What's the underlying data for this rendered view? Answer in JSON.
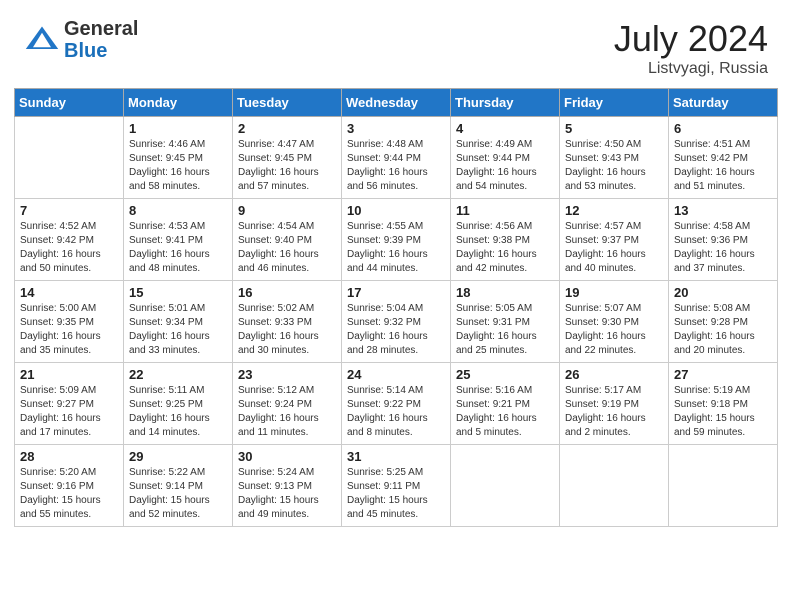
{
  "header": {
    "logo_general": "General",
    "logo_blue": "Blue",
    "month_year": "July 2024",
    "location": "Listvyagi, Russia"
  },
  "days_of_week": [
    "Sunday",
    "Monday",
    "Tuesday",
    "Wednesday",
    "Thursday",
    "Friday",
    "Saturday"
  ],
  "weeks": [
    [
      {
        "day": "",
        "sunrise": "",
        "sunset": "",
        "daylight": ""
      },
      {
        "day": "1",
        "sunrise": "Sunrise: 4:46 AM",
        "sunset": "Sunset: 9:45 PM",
        "daylight": "Daylight: 16 hours and 58 minutes."
      },
      {
        "day": "2",
        "sunrise": "Sunrise: 4:47 AM",
        "sunset": "Sunset: 9:45 PM",
        "daylight": "Daylight: 16 hours and 57 minutes."
      },
      {
        "day": "3",
        "sunrise": "Sunrise: 4:48 AM",
        "sunset": "Sunset: 9:44 PM",
        "daylight": "Daylight: 16 hours and 56 minutes."
      },
      {
        "day": "4",
        "sunrise": "Sunrise: 4:49 AM",
        "sunset": "Sunset: 9:44 PM",
        "daylight": "Daylight: 16 hours and 54 minutes."
      },
      {
        "day": "5",
        "sunrise": "Sunrise: 4:50 AM",
        "sunset": "Sunset: 9:43 PM",
        "daylight": "Daylight: 16 hours and 53 minutes."
      },
      {
        "day": "6",
        "sunrise": "Sunrise: 4:51 AM",
        "sunset": "Sunset: 9:42 PM",
        "daylight": "Daylight: 16 hours and 51 minutes."
      }
    ],
    [
      {
        "day": "7",
        "sunrise": "Sunrise: 4:52 AM",
        "sunset": "Sunset: 9:42 PM",
        "daylight": "Daylight: 16 hours and 50 minutes."
      },
      {
        "day": "8",
        "sunrise": "Sunrise: 4:53 AM",
        "sunset": "Sunset: 9:41 PM",
        "daylight": "Daylight: 16 hours and 48 minutes."
      },
      {
        "day": "9",
        "sunrise": "Sunrise: 4:54 AM",
        "sunset": "Sunset: 9:40 PM",
        "daylight": "Daylight: 16 hours and 46 minutes."
      },
      {
        "day": "10",
        "sunrise": "Sunrise: 4:55 AM",
        "sunset": "Sunset: 9:39 PM",
        "daylight": "Daylight: 16 hours and 44 minutes."
      },
      {
        "day": "11",
        "sunrise": "Sunrise: 4:56 AM",
        "sunset": "Sunset: 9:38 PM",
        "daylight": "Daylight: 16 hours and 42 minutes."
      },
      {
        "day": "12",
        "sunrise": "Sunrise: 4:57 AM",
        "sunset": "Sunset: 9:37 PM",
        "daylight": "Daylight: 16 hours and 40 minutes."
      },
      {
        "day": "13",
        "sunrise": "Sunrise: 4:58 AM",
        "sunset": "Sunset: 9:36 PM",
        "daylight": "Daylight: 16 hours and 37 minutes."
      }
    ],
    [
      {
        "day": "14",
        "sunrise": "Sunrise: 5:00 AM",
        "sunset": "Sunset: 9:35 PM",
        "daylight": "Daylight: 16 hours and 35 minutes."
      },
      {
        "day": "15",
        "sunrise": "Sunrise: 5:01 AM",
        "sunset": "Sunset: 9:34 PM",
        "daylight": "Daylight: 16 hours and 33 minutes."
      },
      {
        "day": "16",
        "sunrise": "Sunrise: 5:02 AM",
        "sunset": "Sunset: 9:33 PM",
        "daylight": "Daylight: 16 hours and 30 minutes."
      },
      {
        "day": "17",
        "sunrise": "Sunrise: 5:04 AM",
        "sunset": "Sunset: 9:32 PM",
        "daylight": "Daylight: 16 hours and 28 minutes."
      },
      {
        "day": "18",
        "sunrise": "Sunrise: 5:05 AM",
        "sunset": "Sunset: 9:31 PM",
        "daylight": "Daylight: 16 hours and 25 minutes."
      },
      {
        "day": "19",
        "sunrise": "Sunrise: 5:07 AM",
        "sunset": "Sunset: 9:30 PM",
        "daylight": "Daylight: 16 hours and 22 minutes."
      },
      {
        "day": "20",
        "sunrise": "Sunrise: 5:08 AM",
        "sunset": "Sunset: 9:28 PM",
        "daylight": "Daylight: 16 hours and 20 minutes."
      }
    ],
    [
      {
        "day": "21",
        "sunrise": "Sunrise: 5:09 AM",
        "sunset": "Sunset: 9:27 PM",
        "daylight": "Daylight: 16 hours and 17 minutes."
      },
      {
        "day": "22",
        "sunrise": "Sunrise: 5:11 AM",
        "sunset": "Sunset: 9:25 PM",
        "daylight": "Daylight: 16 hours and 14 minutes."
      },
      {
        "day": "23",
        "sunrise": "Sunrise: 5:12 AM",
        "sunset": "Sunset: 9:24 PM",
        "daylight": "Daylight: 16 hours and 11 minutes."
      },
      {
        "day": "24",
        "sunrise": "Sunrise: 5:14 AM",
        "sunset": "Sunset: 9:22 PM",
        "daylight": "Daylight: 16 hours and 8 minutes."
      },
      {
        "day": "25",
        "sunrise": "Sunrise: 5:16 AM",
        "sunset": "Sunset: 9:21 PM",
        "daylight": "Daylight: 16 hours and 5 minutes."
      },
      {
        "day": "26",
        "sunrise": "Sunrise: 5:17 AM",
        "sunset": "Sunset: 9:19 PM",
        "daylight": "Daylight: 16 hours and 2 minutes."
      },
      {
        "day": "27",
        "sunrise": "Sunrise: 5:19 AM",
        "sunset": "Sunset: 9:18 PM",
        "daylight": "Daylight: 15 hours and 59 minutes."
      }
    ],
    [
      {
        "day": "28",
        "sunrise": "Sunrise: 5:20 AM",
        "sunset": "Sunset: 9:16 PM",
        "daylight": "Daylight: 15 hours and 55 minutes."
      },
      {
        "day": "29",
        "sunrise": "Sunrise: 5:22 AM",
        "sunset": "Sunset: 9:14 PM",
        "daylight": "Daylight: 15 hours and 52 minutes."
      },
      {
        "day": "30",
        "sunrise": "Sunrise: 5:24 AM",
        "sunset": "Sunset: 9:13 PM",
        "daylight": "Daylight: 15 hours and 49 minutes."
      },
      {
        "day": "31",
        "sunrise": "Sunrise: 5:25 AM",
        "sunset": "Sunset: 9:11 PM",
        "daylight": "Daylight: 15 hours and 45 minutes."
      },
      {
        "day": "",
        "sunrise": "",
        "sunset": "",
        "daylight": ""
      },
      {
        "day": "",
        "sunrise": "",
        "sunset": "",
        "daylight": ""
      },
      {
        "day": "",
        "sunrise": "",
        "sunset": "",
        "daylight": ""
      }
    ]
  ]
}
